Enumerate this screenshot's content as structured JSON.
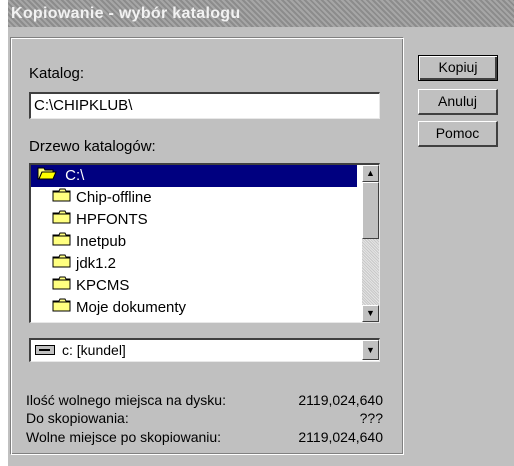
{
  "window": {
    "title": "Kopiowanie - wybór katalogu"
  },
  "katalog": {
    "label": "Katalog:",
    "value": "C:\\CHIPKLUB\\"
  },
  "tree": {
    "label": "Drzewo katalogów:",
    "root": "C:\\",
    "items": [
      "Chip-offline",
      "HPFONTS",
      "Inetpub",
      "jdk1.2",
      "KPCMS",
      "Moje dokumenty"
    ]
  },
  "drive": {
    "value": "c: [kundel]"
  },
  "stats": {
    "free_label": "Ilość wolnego miejsca na dysku:",
    "free_value": "2119,024,640",
    "copy_label": "Do skopiowania:",
    "copy_value": "???",
    "after_label": "Wolne miejsce po skopiowaniu:",
    "after_value": "2119,024,640"
  },
  "buttons": {
    "kopiuj": "Kopiuj",
    "anuluj": "Anuluj",
    "pomoc": "Pomoc"
  },
  "icons": {
    "folder": "folder-icon",
    "open_folder": "open-folder-icon",
    "drive": "drive-icon",
    "scroll_up": "arrow-up-icon",
    "scroll_down": "arrow-down-icon",
    "dropdown": "chevron-down-icon"
  }
}
